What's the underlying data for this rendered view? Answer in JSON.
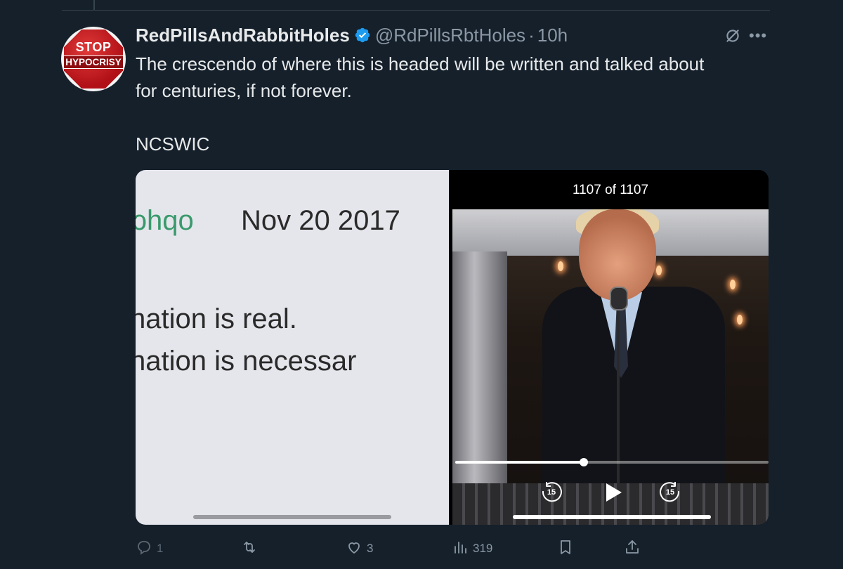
{
  "tweet": {
    "display_name": "RedPillsAndRabbitHoles",
    "handle": "@RdPillsRbtHoles",
    "separator": "·",
    "time": "10h",
    "text_line1": "The crescendo of where this is headed will be written and talked about",
    "text_line2": "for centuries, if not forever.",
    "text_line3": "NCSWIC",
    "verified": true
  },
  "avatar": {
    "top_text": "STOP",
    "bottom_text": "HYPOCRISY"
  },
  "media": {
    "left": {
      "user_fragment": "ɔhqo",
      "date": "Nov 20 2017",
      "line1": "nation is real.",
      "line2": "nation is necessar"
    },
    "right": {
      "counter": "1107 of 1107",
      "progress": 0.41,
      "skip_back_label": "15",
      "skip_forward_label": "15"
    }
  },
  "actions": {
    "reply_count": "1",
    "retweet_count": "",
    "like_count": "3",
    "views_count": "319"
  },
  "icons": {
    "verified": "verified-badge-icon",
    "grok": "grok-icon",
    "more": "more-icon",
    "reply": "reply-icon",
    "retweet": "retweet-icon",
    "like": "heart-icon",
    "views": "views-icon",
    "bookmark": "bookmark-icon",
    "share": "share-icon"
  },
  "colors": {
    "background": "#15202b",
    "text": "#e7e9ea",
    "muted": "#8b98a5",
    "verified": "#1d9bf0"
  }
}
